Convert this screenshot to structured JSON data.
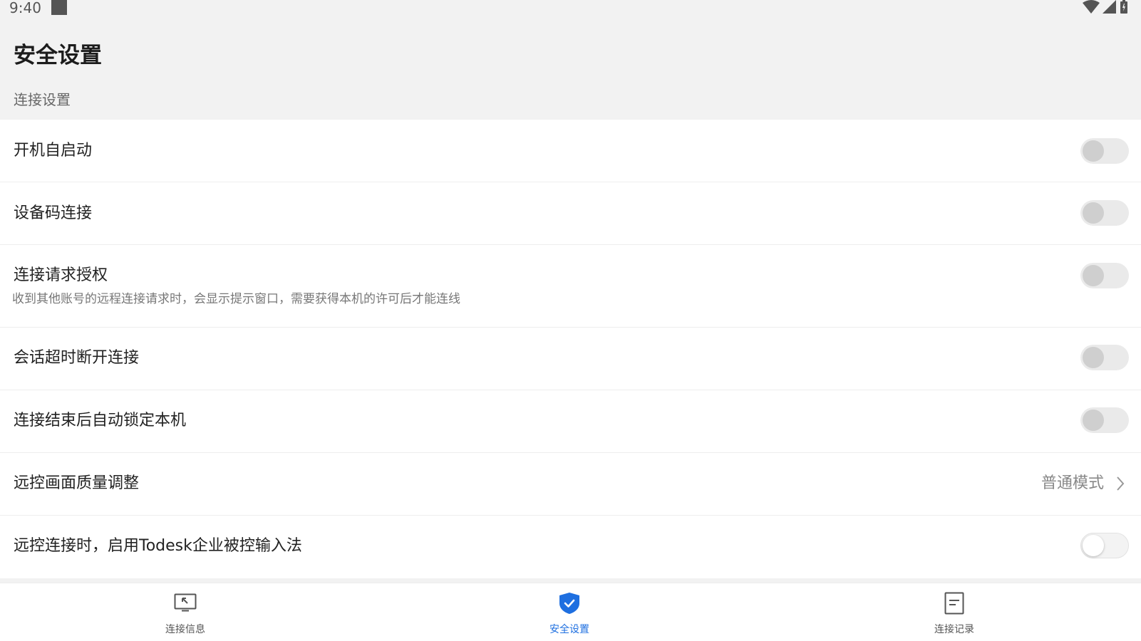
{
  "status_bar": {
    "time": "9:40"
  },
  "page_title": "安全设置",
  "section_label": "连接设置",
  "settings": [
    {
      "label": "开机自启动",
      "type": "toggle",
      "on": false
    },
    {
      "label": "设备码连接",
      "type": "toggle",
      "on": false
    },
    {
      "label": "连接请求授权",
      "description": "收到其他账号的远程连接请求时，会显示提示窗口，需要获得本机的许可后才能连线",
      "type": "toggle",
      "on": false
    },
    {
      "label": "会话超时断开连接",
      "type": "toggle",
      "on": false
    },
    {
      "label": "连接结束后自动锁定本机",
      "type": "toggle",
      "on": false
    },
    {
      "label": "远控画面质量调整",
      "type": "select",
      "value": "普通模式"
    },
    {
      "label": "远控连接时，启用Todesk企业被控输入法",
      "type": "toggle",
      "on": false
    }
  ],
  "bottom_nav": [
    {
      "label": "连接信息",
      "icon": "monitor-icon",
      "active": false
    },
    {
      "label": "安全设置",
      "icon": "shield-icon",
      "active": true
    },
    {
      "label": "连接记录",
      "icon": "document-icon",
      "active": false
    }
  ],
  "colors": {
    "accent": "#1e6fe0",
    "page_background": "#f2f2f2",
    "card_background": "#ffffff"
  }
}
